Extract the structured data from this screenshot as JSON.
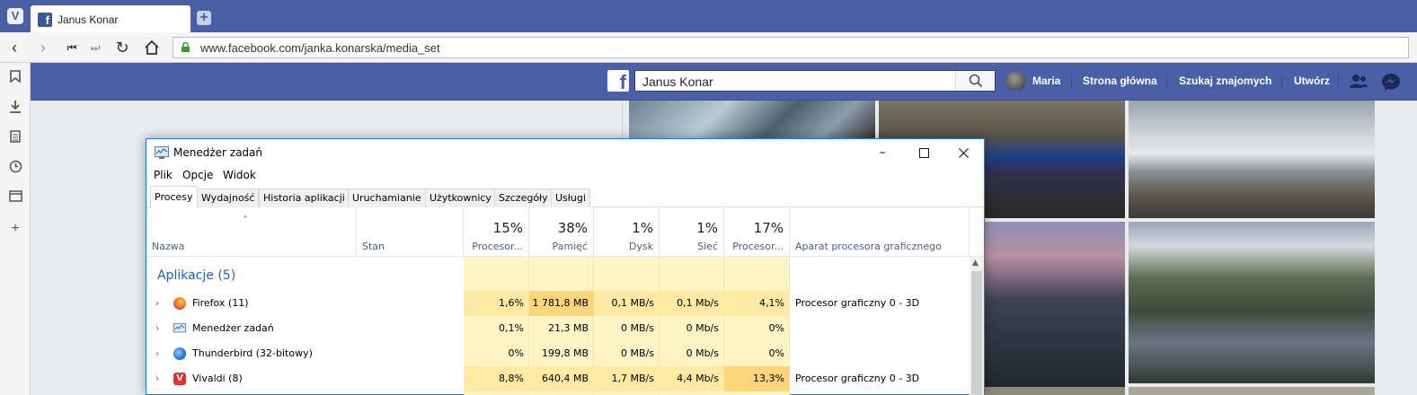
{
  "browser": {
    "tab_title": "Janus Konar",
    "url": "www.facebook.com/janka.konarska/media_set"
  },
  "facebook": {
    "search_value": "Janus Konar",
    "user_name": "Maria",
    "nav": [
      "Strona główna",
      "Szukaj znajomych",
      "Utwórz"
    ]
  },
  "task_manager": {
    "title": "Menedżer zadań",
    "menu": [
      "Plik",
      "Opcje",
      "Widok"
    ],
    "tabs": [
      "Procesy",
      "Wydajność",
      "Historia aplikacji",
      "Uruchamianie",
      "Użytkownicy",
      "Szczegóły",
      "Usługi"
    ],
    "active_tab": "Procesy",
    "columns": {
      "name": "Nazwa",
      "status": "Stan",
      "cpu": {
        "pct": "15%",
        "label": "Procesor..."
      },
      "memory": {
        "pct": "38%",
        "label": "Pamięć"
      },
      "disk": {
        "pct": "1%",
        "label": "Dysk"
      },
      "network": {
        "pct": "1%",
        "label": "Sieć"
      },
      "gpu": {
        "pct": "17%",
        "label": "Procesor..."
      },
      "gpu_engine": "Aparat procesora graficznego"
    },
    "group_label": "Aplikacje (5)",
    "rows": [
      {
        "name": "Firefox (11)",
        "cpu": "1,6%",
        "memory": "1 781,8 MB",
        "disk": "0,1 MB/s",
        "network": "0,1 Mb/s",
        "gpu": "4,1%",
        "gpu_engine": "Procesor graficzny 0 - 3D"
      },
      {
        "name": "Menedżer zadań",
        "cpu": "0,1%",
        "memory": "21,3 MB",
        "disk": "0 MB/s",
        "network": "0 Mb/s",
        "gpu": "0%",
        "gpu_engine": ""
      },
      {
        "name": "Thunderbird (32-bitowy)",
        "cpu": "0%",
        "memory": "199,8 MB",
        "disk": "0 MB/s",
        "network": "0 Mb/s",
        "gpu": "0%",
        "gpu_engine": ""
      },
      {
        "name": "Vivaldi (8)",
        "cpu": "8,8%",
        "memory": "640,4 MB",
        "disk": "1,7 MB/s",
        "network": "4,4 Mb/s",
        "gpu": "13,3%",
        "gpu_engine": "Procesor graficzny 0 - 3D"
      }
    ]
  },
  "colors": {
    "browser_accent": "#4a5fa8",
    "heat_light": "#fff4c4",
    "heat_mid": "#ffe9a3",
    "heat_high": "#ffd47a",
    "group_blue": "#1e63c4"
  }
}
